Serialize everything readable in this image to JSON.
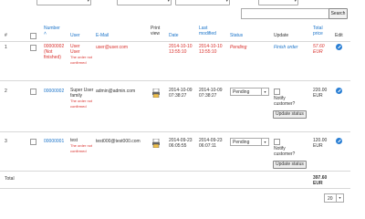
{
  "toolbar": {
    "search_button": "Search",
    "search_placeholder": ""
  },
  "columns": {
    "num": "#",
    "number": "Number",
    "user": "User",
    "email": "E-Mail",
    "print_view_1": "Print",
    "print_view_2": "view",
    "date": "Date",
    "last_modified_1": "Last",
    "last_modified_2": "modified",
    "status": "Status",
    "update": "Update",
    "total_price_1": "Total",
    "total_price_2": "price",
    "edit": "Edit"
  },
  "orders": [
    {
      "row_num": "1",
      "number": "00000002",
      "number_note": "(Not finished)",
      "user_name": "User",
      "user_role": "User",
      "user_note": "The order not confirmed",
      "email": "user@user.com",
      "date_1": "2014-10-10",
      "date_2": "13:55:10",
      "modified_1": "2014-10-10",
      "modified_2": "13:55:10",
      "status": "Pending",
      "update": "Finish order",
      "price_1": "57.60",
      "price_2": "EUR"
    },
    {
      "row_num": "2",
      "number": "00000002",
      "user_name": "Super User family",
      "user_note": "The order not confirmed",
      "email": "admin@admin.com",
      "date_1": "2014-10-09",
      "date_2": "07:38:27",
      "modified_1": "2014-10-09",
      "modified_2": "07:38:27",
      "status": "Pending",
      "notify": "Notify customer?",
      "update_btn": "Update status",
      "price_1": "220.00",
      "price_2": "EUR"
    },
    {
      "row_num": "3",
      "number": "00000001",
      "user_name": "test",
      "user_note": "The order not confirmed",
      "email": "test000@test000.com",
      "date_1": "2014-09-23",
      "date_2": "06:05:55",
      "modified_1": "2014-09-23",
      "modified_2": "06:07:11",
      "status": "Pending",
      "notify": "Notify customer?",
      "update_btn": "Update status",
      "price_1": "120.00",
      "price_2": "EUR"
    }
  ],
  "footer": {
    "total_label": "Total",
    "total_1": "397.60",
    "total_2": "EUR",
    "per_page": "20"
  }
}
